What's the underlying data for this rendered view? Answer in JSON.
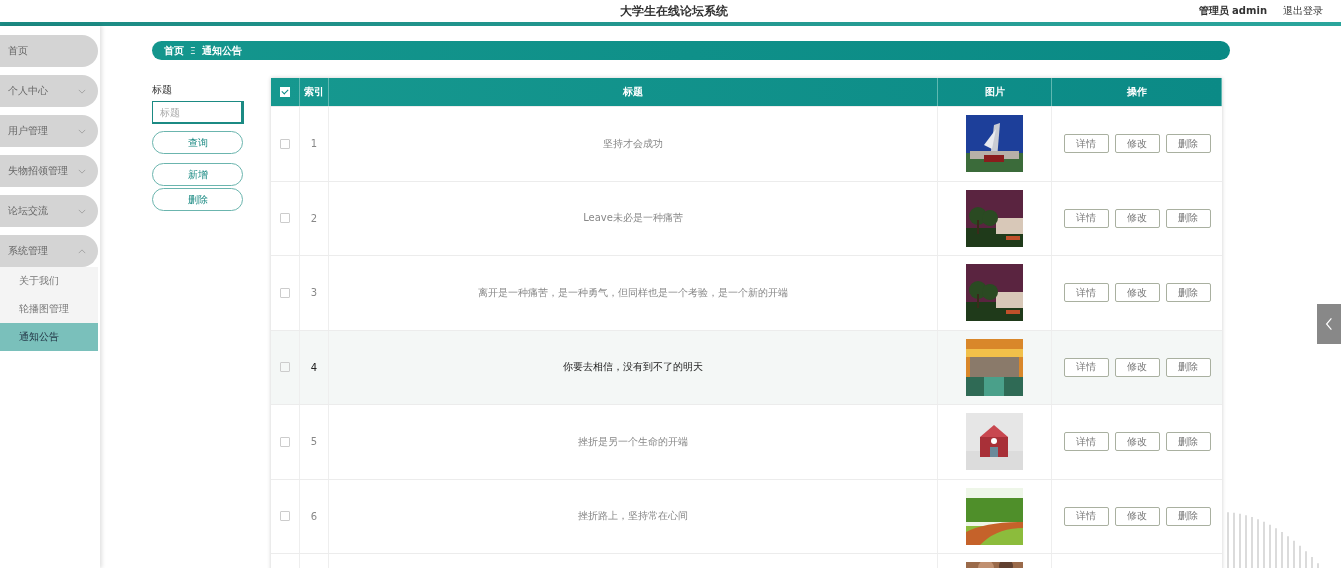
{
  "header": {
    "title": "大学生在线论坛系统",
    "user": "管理员 admin",
    "logout": "退出登录"
  },
  "sidebar": {
    "items": [
      {
        "label": "首页",
        "expandable": false
      },
      {
        "label": "个人中心",
        "expandable": true,
        "expanded": false
      },
      {
        "label": "用户管理",
        "expandable": true,
        "expanded": false
      },
      {
        "label": "失物招领管理",
        "expandable": true,
        "expanded": false
      },
      {
        "label": "论坛交流",
        "expandable": true,
        "expanded": false
      },
      {
        "label": "系统管理",
        "expandable": true,
        "expanded": true,
        "children": [
          {
            "label": "关于我们",
            "selected": false
          },
          {
            "label": "轮播图管理",
            "selected": false
          },
          {
            "label": "通知公告",
            "selected": true
          }
        ]
      }
    ]
  },
  "breadcrumb": {
    "home": "首页",
    "separator": "Ξ",
    "current": "通知公告"
  },
  "search": {
    "label": "标题",
    "placeholder": "标题",
    "query_button": "查询",
    "add_button": "新增",
    "delete_button": "删除"
  },
  "table": {
    "header_checked": true,
    "columns": [
      "索引",
      "标题",
      "图片",
      "操作"
    ],
    "rows": [
      {
        "index": "1",
        "title": "坚持才会成功",
        "checked": false,
        "highlighted": false,
        "image": {
          "kind": "picture"
        },
        "actions": [
          "详情",
          "修改",
          "删除"
        ]
      },
      {
        "index": "2",
        "title": "Leave未必是一种痛苦",
        "checked": false,
        "highlighted": false,
        "image": {
          "kind": "picture"
        },
        "actions": [
          "详情",
          "修改",
          "删除"
        ]
      },
      {
        "index": "3",
        "title": "离开是一种痛苦，是一种勇气，但同样也是一个考验，是一个新的开端",
        "checked": false,
        "highlighted": false,
        "image": {
          "kind": "picture"
        },
        "actions": [
          "详情",
          "修改",
          "删除"
        ]
      },
      {
        "index": "4",
        "title": "你要去相信，没有到不了的明天",
        "checked": false,
        "highlighted": true,
        "image": {
          "kind": "picture"
        },
        "actions": [
          "详情",
          "修改",
          "删除"
        ]
      },
      {
        "index": "5",
        "title": "挫折是另一个生命的开端",
        "checked": false,
        "highlighted": false,
        "image": {
          "kind": "picture"
        },
        "actions": [
          "详情",
          "修改",
          "删除"
        ]
      },
      {
        "index": "6",
        "title": "挫折路上，坚持常在心间",
        "checked": false,
        "highlighted": false,
        "image": {
          "kind": "picture"
        },
        "actions": [
          "详情",
          "修改",
          "删除"
        ]
      },
      {
        "image": {
          "kind": "picture"
        }
      }
    ]
  }
}
